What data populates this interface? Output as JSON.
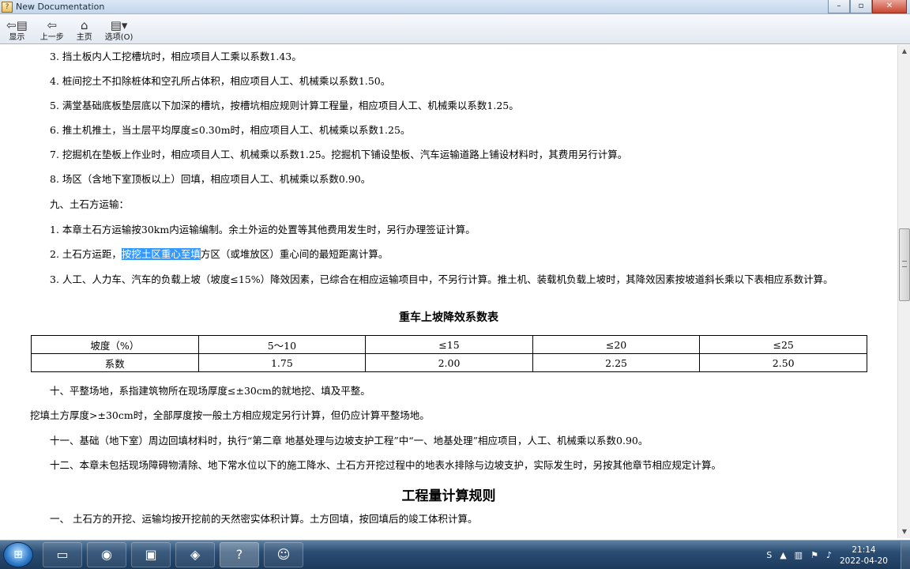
{
  "window": {
    "title": "New Documentation",
    "buttons": {
      "minimize": "–",
      "maximize": "▫",
      "close": "✕"
    }
  },
  "toolbar": {
    "items": [
      {
        "label": "显示",
        "icon": "show-panel-icon"
      },
      {
        "label": "上一步",
        "icon": "back-arrow-icon"
      },
      {
        "label": "主页",
        "icon": "home-icon"
      },
      {
        "label": "选项(O)",
        "icon": "options-icon"
      }
    ]
  },
  "content": {
    "lines": [
      "3. 挡土板内人工挖槽坑时，相应项目人工乘以系数1.43。",
      "4. 桩间挖土不扣除桩体和空孔所占体积，相应项目人工、机械乘以系数1.50。",
      "5. 满堂基础底板垫层底以下加深的槽坑，按槽坑相应规则计算工程量，相应项目人工、机械乘以系数1.25。",
      "6. 推土机推土，当土层平均厚度≤0.30m时，相应项目人工、机械乘以系数1.25。",
      "7. 挖掘机在垫板上作业时，相应项目人工、机械乘以系数1.25。挖掘机下铺设垫板、汽车运输道路上铺设材料时，其费用另行计算。",
      "8. 场区（含地下室顶板以上）回填，相应项目人工、机械乘以系数0.90。",
      "九、土石方运输：",
      "1. 本章土石方运输按30km内运输编制。余土外运的处置等其他费用发生时，另行办理签证计算。"
    ],
    "line_hl": {
      "before": "2. 土石方运距，",
      "highlight": "按挖土区重心至填",
      "after": "方区（或堆放区）重心间的最短距离计算。"
    },
    "line_wrap": "3. 人工、人力车、汽车的负载上坡（坡度≤15%）降效因素，已综合在相应运输项目中，不另行计算。推土机、装载机负载上坡时，其降效因素按坡道斜长乘以下表相应系数计算。",
    "table_title": "重车上坡降效系数表",
    "table": {
      "header": [
        "坡度（%）",
        "5～10",
        "≤15",
        "≤20",
        "≤25"
      ],
      "row": [
        "系数",
        "1.75",
        "2.00",
        "2.25",
        "2.50"
      ]
    },
    "after_table": [
      "十、平整场地，系指建筑物所在现场厚度≤±30cm的就地挖、填及平整。",
      "挖填土方厚度>±30cm时，全部厚度按一般土方相应规定另行计算，但仍应计算平整场地。",
      "十一、基础（地下室）周边回填材料时，执行“第二章 地基处理与边坡支护工程”中“一、地基处理”相应项目，人工、机械乘以系数0.90。",
      "十二、本章未包括现场障碍物清除、地下常水位以下的施工降水、土石方开挖过程中的地表水排除与边坡支护，实际发生时，另按其他章节相应规定计算。"
    ],
    "section_title": "工程量计算规则",
    "last_line": "一、 土石方的开挖、运输均按开挖前的天然密实体积计算。土方回填，按回填后的竣工体积计算。"
  },
  "taskbar": {
    "time": "21:14",
    "date": "2022-04-20",
    "tray_labels": [
      "S"
    ]
  }
}
